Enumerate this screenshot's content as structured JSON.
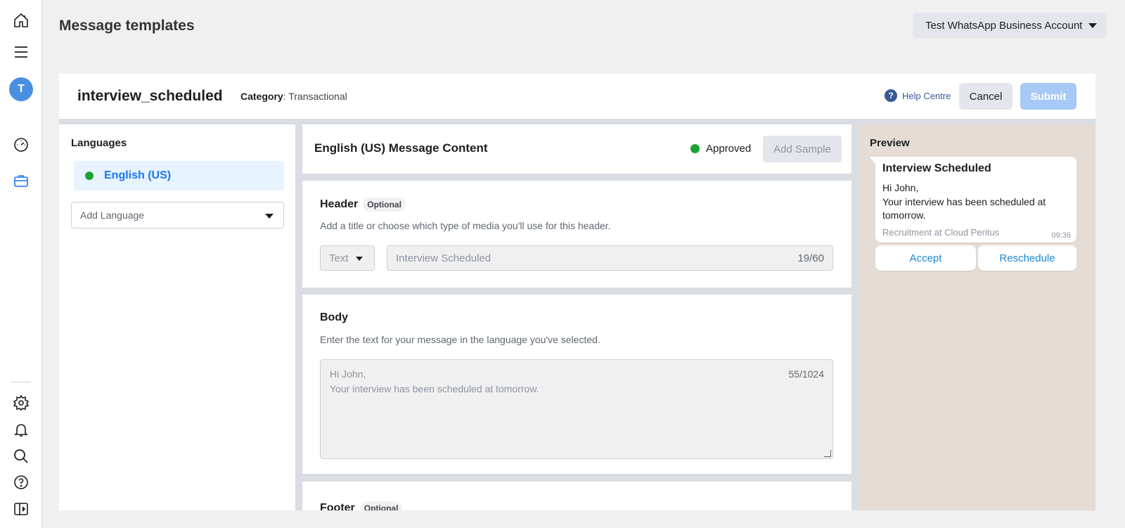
{
  "app": {
    "title": "Message templates"
  },
  "rail": {
    "avatar_letter": "T"
  },
  "account": {
    "label": "Test WhatsApp Business Account"
  },
  "template": {
    "name": "interview_scheduled",
    "category_label": "Category",
    "category_value": ": Transactional"
  },
  "actions": {
    "help": "Help Centre",
    "cancel": "Cancel",
    "submit": "Submit"
  },
  "languages": {
    "heading": "Languages",
    "items": [
      {
        "label": "English (US)",
        "status_color": "#1ba32f"
      }
    ],
    "add_placeholder": "Add Language"
  },
  "content": {
    "title": "English (US) Message Content",
    "status": "Approved",
    "add_sample": "Add Sample"
  },
  "header_section": {
    "title": "Header",
    "badge": "Optional",
    "description": "Add a title or choose which type of media you'll use for this header.",
    "type_value": "Text",
    "input_value": "Interview Scheduled",
    "count": "19/60"
  },
  "body_section": {
    "title": "Body",
    "description": "Enter the text for your message in the language you've selected.",
    "line1": "Hi John,",
    "line2": "Your interview has been scheduled at tomorrow.",
    "count": "55/1024"
  },
  "footer_section": {
    "title": "Footer",
    "badge": "Optional"
  },
  "preview": {
    "heading": "Preview",
    "title": "Interview Scheduled",
    "line1": "Hi John,",
    "line2": "Your interview has been scheduled at tomorrow.",
    "footer": "Recruitment at Cloud Peritus",
    "time": "09:36",
    "buttons": [
      "Accept",
      "Reschedule"
    ]
  },
  "colors": {
    "accent": "#1877f2",
    "approved": "#1ba32f",
    "preview_bg": "#e5ddd5",
    "submit_disabled": "#a6c9f5"
  }
}
